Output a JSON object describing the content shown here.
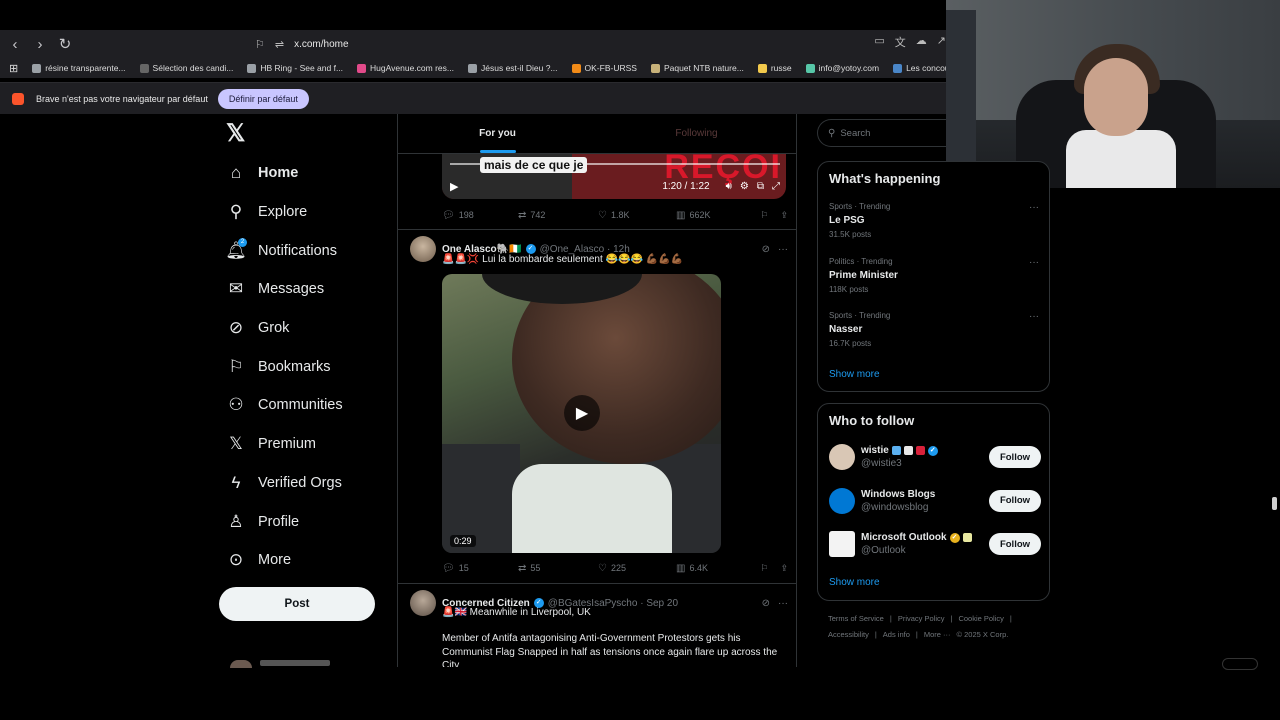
{
  "browser": {
    "url": "x.com/home",
    "bookmarks": [
      {
        "label": "résine transparente...",
        "color": "#9aa0a6"
      },
      {
        "label": "Sélection des candi...",
        "color": "#666666"
      },
      {
        "label": "HB Ring - See and f...",
        "color": "#9aa0a6"
      },
      {
        "label": "HugAvenue.com res...",
        "color": "#e24a8a"
      },
      {
        "label": "Jésus est-il Dieu ?...",
        "color": "#9aa0a6"
      },
      {
        "label": "OK-FB-URSS",
        "color": "#f28b18"
      },
      {
        "label": "Paquet NTB nature...",
        "color": "#c8b27a"
      },
      {
        "label": "russe",
        "color": "#f2c94c"
      },
      {
        "label": "info@yotoy.com",
        "color": "#57c7a8"
      },
      {
        "label": "Les concours d'aute...",
        "color": "#4a86c8"
      }
    ],
    "infobar": {
      "message": "Brave n'est pas votre navigateur par défaut",
      "button": "Définir par défaut"
    }
  },
  "nav": {
    "items": [
      {
        "label": "Home",
        "icon": "⌂"
      },
      {
        "label": "Explore",
        "icon": "⚲"
      },
      {
        "label": "Notifications",
        "icon": "🔔︎",
        "badge": "2"
      },
      {
        "label": "Messages",
        "icon": "✉"
      },
      {
        "label": "Grok",
        "icon": "⊘"
      },
      {
        "label": "Bookmarks",
        "icon": "⚐"
      },
      {
        "label": "Communities",
        "icon": "⚇"
      },
      {
        "label": "Premium",
        "icon": "𝕏"
      },
      {
        "label": "Verified Orgs",
        "icon": "ϟ"
      },
      {
        "label": "Profile",
        "icon": "♙"
      },
      {
        "label": "More",
        "icon": "⊙"
      }
    ],
    "post_button": "Post"
  },
  "feed": {
    "tabs": [
      "For you",
      "Following"
    ],
    "video1": {
      "subtitle": "mais de ce que je",
      "bg_text": "REÇOI",
      "time": "1:20 / 1:22"
    },
    "tweet1_stats": {
      "replies": "198",
      "reposts": "742",
      "likes": "1.8K",
      "views": "662K"
    },
    "tweet2": {
      "name": "One Alasco🐘🇨🇮",
      "handle": "@One_Alasco",
      "time": "12h",
      "text": "🚨🚨💢 Lui la bombarde seulement 😂😂😂 💪🏾💪🏾💪🏾",
      "duration": "0:29",
      "stats": {
        "replies": "15",
        "reposts": "55",
        "likes": "225",
        "views": "6.4K"
      }
    },
    "tweet3": {
      "name": "Concerned Citizen",
      "handle": "@BGatesIsaPyscho",
      "time": "Sep 20",
      "line1": "🚨🇬🇧 Meanwhile in Liverpool, UK",
      "body": "Member of Antifa antagonising Anti-Government Protestors gets his Communist Flag Snapped in half as tensions once again flare up across the City"
    }
  },
  "sidebar": {
    "search_placeholder": "Search",
    "happening": {
      "title": "What's happening",
      "trends": [
        {
          "meta": "Sports · Trending",
          "name": "Le PSG",
          "posts": "31.5K posts"
        },
        {
          "meta": "Politics · Trending",
          "name": "Prime Minister",
          "posts": "118K posts"
        },
        {
          "meta": "Sports · Trending",
          "name": "Nasser",
          "posts": "16.7K posts"
        }
      ],
      "show_more": "Show more"
    },
    "who_to_follow": {
      "title": "Who to follow",
      "accounts": [
        {
          "name": "wistie",
          "handle": "@wistie3",
          "button": "Follow",
          "avatar_color": "#d9c7b5"
        },
        {
          "name": "Windows Blogs",
          "handle": "@windowsblog",
          "button": "Follow",
          "avatar_color": "#0078d4"
        },
        {
          "name": "Microsoft Outlook",
          "handle": "@Outlook",
          "button": "Follow",
          "avatar_color": "#f3f3f3"
        }
      ],
      "show_more": "Show more"
    },
    "footer": {
      "line1": [
        "Terms of Service",
        "|",
        "Privacy Policy",
        "|",
        "Cookie Policy",
        "|"
      ],
      "line2": [
        "Accessibility",
        "|",
        "Ads info",
        "|",
        "More ···",
        "© 2025 X Corp."
      ]
    }
  },
  "colors": {
    "accent": "#1d9bf0",
    "background": "#000000",
    "chrome": "#1f1f23"
  }
}
